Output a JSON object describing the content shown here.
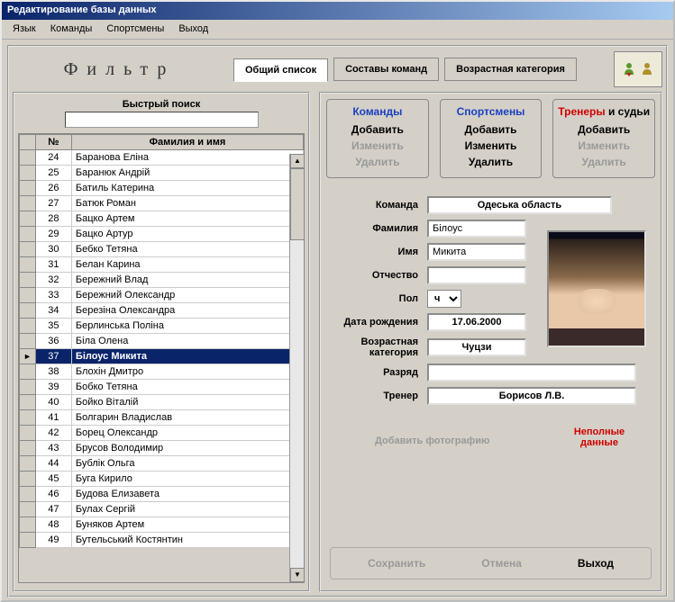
{
  "title": "Редактирование базы данных",
  "menu": [
    "Язык",
    "Команды",
    "Спортсмены",
    "Выход"
  ],
  "filter_label": "Фильтр",
  "tabs": {
    "common": "Общий список",
    "teams": "Составы команд",
    "agecat": "Возрастная категория"
  },
  "quick_search": {
    "label": "Быстрый поиск",
    "value": ""
  },
  "grid_headers": {
    "num": "№",
    "name": "Фамилия и имя"
  },
  "rows": [
    {
      "n": "24",
      "name": "Баранова Еліна"
    },
    {
      "n": "25",
      "name": "Баранюк Андрій"
    },
    {
      "n": "26",
      "name": "Батиль Катерина"
    },
    {
      "n": "27",
      "name": "Батюк Роман"
    },
    {
      "n": "28",
      "name": "Бацко Артем"
    },
    {
      "n": "29",
      "name": "Бацко Артур"
    },
    {
      "n": "30",
      "name": "Бебко Тетяна"
    },
    {
      "n": "31",
      "name": "Белан Карина"
    },
    {
      "n": "32",
      "name": "Бережний Влад"
    },
    {
      "n": "33",
      "name": "Бережний Олександр"
    },
    {
      "n": "34",
      "name": "Березіна Олександра"
    },
    {
      "n": "35",
      "name": "Берлинська Поліна"
    },
    {
      "n": "36",
      "name": "Біла Олена"
    },
    {
      "n": "37",
      "name": "Білоус Микита",
      "selected": true
    },
    {
      "n": "38",
      "name": "Блохін Дмитро"
    },
    {
      "n": "39",
      "name": "Бобко Тетяна"
    },
    {
      "n": "40",
      "name": "Бойко Віталій"
    },
    {
      "n": "41",
      "name": "Болгарин Владислав"
    },
    {
      "n": "42",
      "name": "Борец Олександр"
    },
    {
      "n": "43",
      "name": "Брусов Володимир"
    },
    {
      "n": "44",
      "name": "Бублік Ольга"
    },
    {
      "n": "45",
      "name": "Буга Кирило"
    },
    {
      "n": "46",
      "name": "Будова Елизавета"
    },
    {
      "n": "47",
      "name": "Булах Сергій"
    },
    {
      "n": "48",
      "name": "Буняков Артем"
    },
    {
      "n": "49",
      "name": "Бутельський Костянтин"
    }
  ],
  "sections": {
    "komandy": {
      "title": "Команды",
      "add": "Добавить",
      "edit": "Изменить",
      "del": "Удалить",
      "edit_disabled": true,
      "del_disabled": true
    },
    "sportsmeny": {
      "title": "Спортсмены",
      "add": "Добавить",
      "edit": "Изменить",
      "del": "Удалить"
    },
    "trenery": {
      "title_a": "Тренеры",
      "title_b": " и судьи",
      "add": "Добавить",
      "edit": "Изменить",
      "del": "Удалить",
      "edit_disabled": true,
      "del_disabled": true
    }
  },
  "form": {
    "labels": {
      "team": "Команда",
      "lname": "Фамилия",
      "fname": "Имя",
      "mname": "Отчество",
      "sex": "Пол",
      "dob": "Дата рождения",
      "agecat": "Возрастная категория",
      "rank": "Разряд",
      "coach": "Тренер"
    },
    "values": {
      "team": "Одеська область",
      "lname": "Білоус",
      "fname": "Микита",
      "mname": "",
      "sex": "ч",
      "dob": "17.06.2000",
      "agecat": "Чуцзи",
      "rank": "",
      "coach": "Борисов Л.В."
    }
  },
  "add_photo": "Добавить фотографию",
  "incomplete": "Неполные данные",
  "footer": {
    "save": "Сохранить",
    "cancel": "Отмена",
    "exit": "Выход"
  }
}
